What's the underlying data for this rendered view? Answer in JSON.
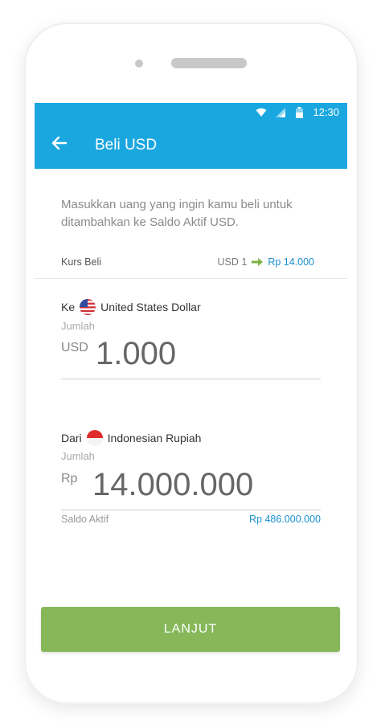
{
  "status_bar": {
    "time": "12:30",
    "icons": [
      "wifi-icon",
      "signal-icon",
      "battery-icon"
    ]
  },
  "app_bar": {
    "title": "Beli USD",
    "back_icon": "arrow-left-icon"
  },
  "description": "Masukkan uang yang ingin kamu beli untuk ditambahkan ke Saldo Aktif USD.",
  "rate": {
    "label": "Kurs Beli",
    "from": "USD 1",
    "to": "Rp 14.000"
  },
  "to_section": {
    "prefix": "Ke",
    "currency_name": "United States Dollar",
    "amount_label": "Jumlah",
    "currency_code": "USD",
    "amount": "1.000",
    "flag_icon": "us-flag-icon"
  },
  "from_section": {
    "prefix": "Dari",
    "currency_name": "Indonesian Rupiah",
    "amount_label": "Jumlah",
    "currency_code": "Rp",
    "amount": "14.000.000",
    "flag_icon": "id-flag-icon"
  },
  "balance": {
    "label": "Saldo Aktif",
    "value": "Rp 486.000.000"
  },
  "button": {
    "label": "LANJUT"
  },
  "colors": {
    "primary": "#1aa7e0",
    "button": "#86b85a",
    "link": "#1a8fcf",
    "arrow": "#7cb342"
  }
}
